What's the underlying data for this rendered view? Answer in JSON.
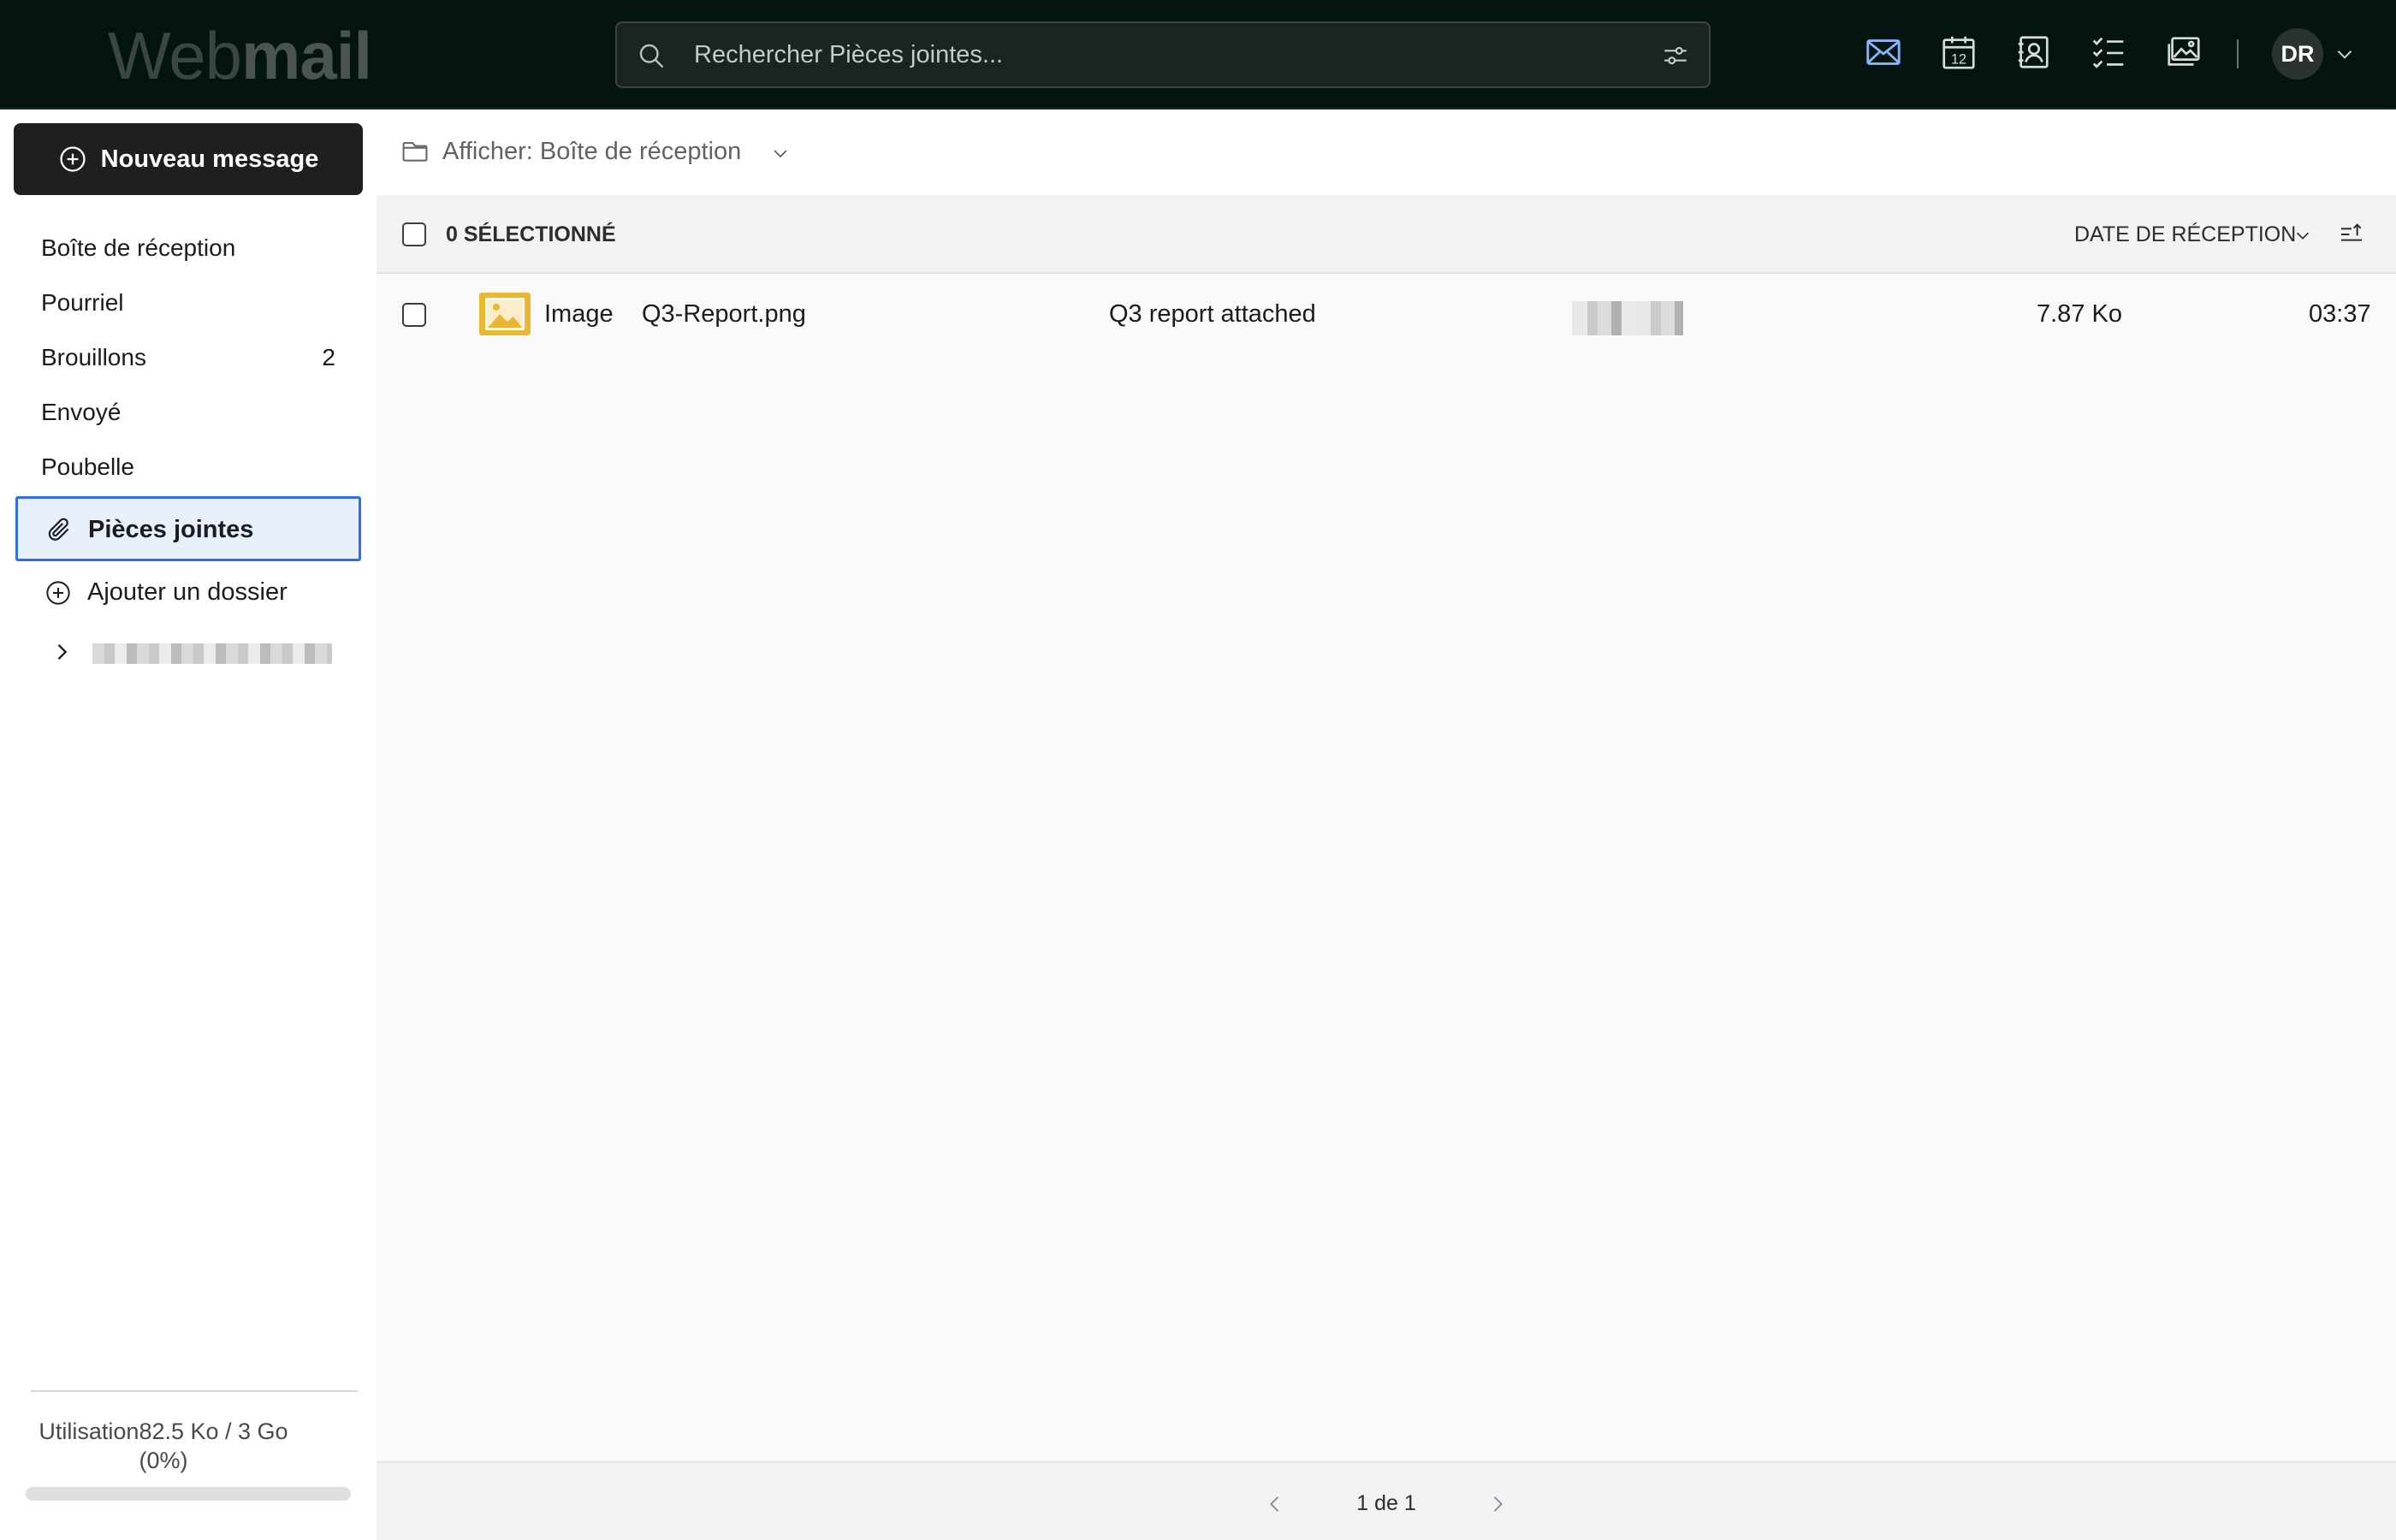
{
  "app": {
    "logo_light": "Web",
    "logo_bold": "mail"
  },
  "search": {
    "placeholder": "Rechercher Pièces jointes..."
  },
  "apps": [
    "mail-icon",
    "calendar-icon",
    "contacts-icon",
    "tasks-icon",
    "photos-icon"
  ],
  "calendar_day": "12",
  "user": {
    "initials": "DR"
  },
  "compose": {
    "label": "Nouveau message"
  },
  "folders": [
    {
      "label": "Boîte de réception",
      "count": ""
    },
    {
      "label": "Pourriel",
      "count": ""
    },
    {
      "label": "Brouillons",
      "count": "2"
    },
    {
      "label": "Envoyé",
      "count": ""
    },
    {
      "label": "Poubelle",
      "count": ""
    }
  ],
  "active_folder": {
    "label": "Pièces jointes"
  },
  "add_folder": {
    "label": "Ajouter un dossier"
  },
  "usage": {
    "line1": "Utilisation82.5 Ko / 3 Go",
    "line2": "(0%)",
    "percent": 0
  },
  "view": {
    "label": "Afficher: Boîte de réception"
  },
  "list": {
    "selected_label": "0 SÉLECTIONNÉ",
    "sort_label": "DATE DE RÉCEPTION",
    "rows": [
      {
        "type": "Image",
        "filename": "Q3-Report.png",
        "subject": "Q3 report attached",
        "size": "7.87 Ko",
        "time": "03:37"
      }
    ]
  },
  "pagination": {
    "label": "1 de 1"
  },
  "colors": {
    "topbar": "#041411",
    "accent": "#2f6fe0",
    "mail_icon": "#8ab4f8",
    "image_thumb": "#e9b730"
  }
}
